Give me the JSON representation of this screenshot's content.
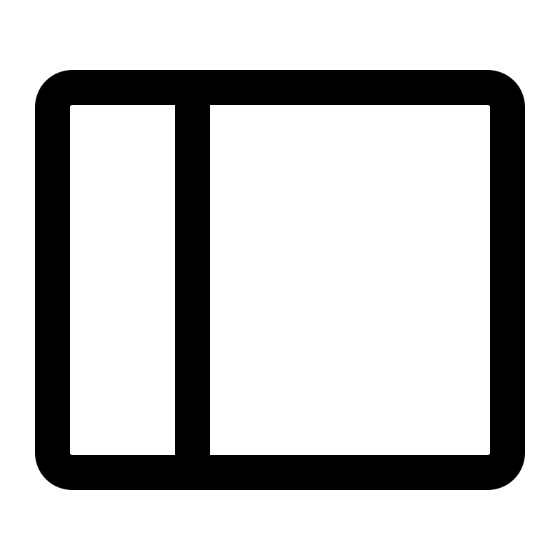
{
  "icon": {
    "name": "sidebar-left-layout-icon",
    "stroke_color": "#000000",
    "background_color": "#ffffff"
  }
}
